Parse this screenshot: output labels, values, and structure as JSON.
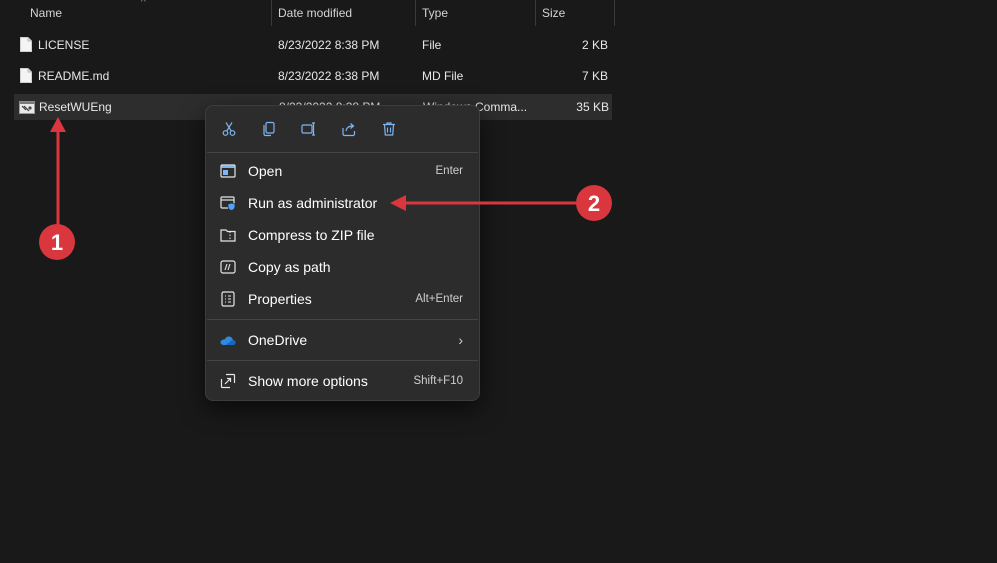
{
  "columns": {
    "name": "Name",
    "date_modified": "Date modified",
    "type": "Type",
    "size": "Size"
  },
  "files": [
    {
      "name": "LICENSE",
      "date": "8/23/2022 8:38 PM",
      "type": "File",
      "size": "2 KB",
      "icon": "file-icon"
    },
    {
      "name": "README.md",
      "date": "8/23/2022 8:38 PM",
      "type": "MD File",
      "size": "7 KB",
      "icon": "file-icon"
    },
    {
      "name": "ResetWUEng",
      "date": "8/23/2022 8:38 PM",
      "type": "Windows Comma...",
      "size": "35 KB",
      "icon": "cmd-script-icon",
      "selected": true
    }
  ],
  "context_menu": {
    "toolbar": [
      "cut-icon",
      "copy-icon",
      "rename-icon",
      "share-icon",
      "delete-icon"
    ],
    "items": [
      {
        "label": "Open",
        "shortcut": "Enter",
        "icon": "open-icon"
      },
      {
        "label": "Run as administrator",
        "shortcut": "",
        "icon": "run-as-admin-icon"
      },
      {
        "label": "Compress to ZIP file",
        "shortcut": "",
        "icon": "zip-icon"
      },
      {
        "label": "Copy as path",
        "shortcut": "",
        "icon": "copy-path-icon"
      },
      {
        "label": "Properties",
        "shortcut": "Alt+Enter",
        "icon": "properties-icon"
      }
    ],
    "onedrive": {
      "label": "OneDrive",
      "icon": "onedrive-icon"
    },
    "more": {
      "label": "Show more options",
      "shortcut": "Shift+F10",
      "icon": "more-options-icon"
    }
  },
  "annotations": [
    {
      "number": "1",
      "color": "#d9363e"
    },
    {
      "number": "2",
      "color": "#d9363e"
    }
  ]
}
